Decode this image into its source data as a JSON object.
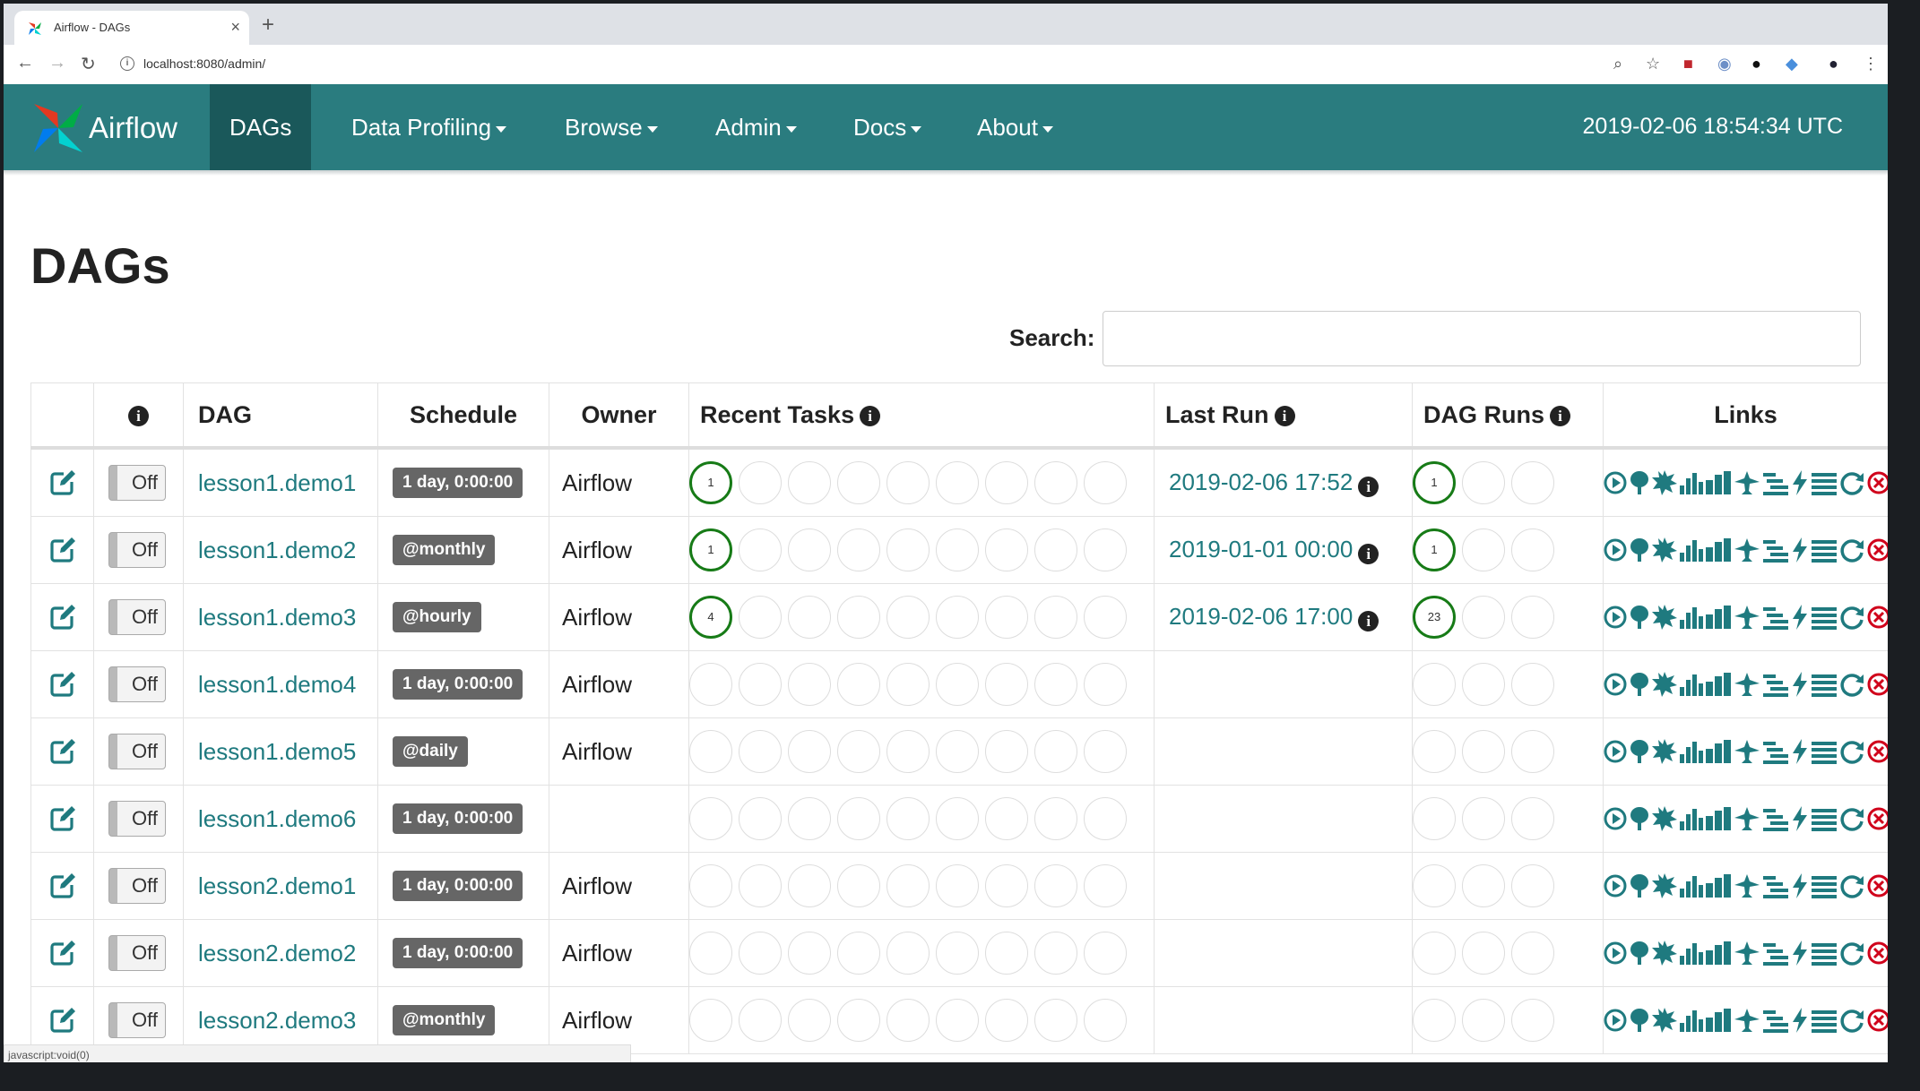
{
  "browser": {
    "tab_title": "Airflow - DAGs",
    "url": "localhost:8080/admin/"
  },
  "navbar": {
    "brand": "Airflow",
    "items": [
      {
        "label": "DAGs"
      },
      {
        "label": "Data Profiling"
      },
      {
        "label": "Browse"
      },
      {
        "label": "Admin"
      },
      {
        "label": "Docs"
      },
      {
        "label": "About"
      }
    ],
    "clock": "2019-02-06 18:54:34 UTC",
    "bg_color": "#2a7c7f",
    "active_color": "#1a585a"
  },
  "page": {
    "title": "DAGs",
    "search_label": "Search:",
    "search_value": ""
  },
  "table": {
    "headers": {
      "dag": "DAG",
      "schedule": "Schedule",
      "owner": "Owner",
      "recent_tasks": "Recent Tasks",
      "last_run": "Last Run",
      "dag_runs": "DAG Runs",
      "links": "Links"
    },
    "rows": [
      {
        "toggle": "Off",
        "dag": "lesson1.demo1",
        "schedule": "1 day, 0:00:00",
        "owner": "Airflow",
        "recent_task_count": "1",
        "last_run": "2019-02-06 17:52",
        "dag_run_count": "1"
      },
      {
        "toggle": "Off",
        "dag": "lesson1.demo2",
        "schedule": "@monthly",
        "owner": "Airflow",
        "recent_task_count": "1",
        "last_run": "2019-01-01 00:00",
        "dag_run_count": "1"
      },
      {
        "toggle": "Off",
        "dag": "lesson1.demo3",
        "schedule": "@hourly",
        "owner": "Airflow",
        "recent_task_count": "4",
        "last_run": "2019-02-06 17:00",
        "dag_run_count": "23"
      },
      {
        "toggle": "Off",
        "dag": "lesson1.demo4",
        "schedule": "1 day, 0:00:00",
        "owner": "Airflow",
        "recent_task_count": "",
        "last_run": "",
        "dag_run_count": ""
      },
      {
        "toggle": "Off",
        "dag": "lesson1.demo5",
        "schedule": "@daily",
        "owner": "Airflow",
        "recent_task_count": "",
        "last_run": "",
        "dag_run_count": ""
      },
      {
        "toggle": "Off",
        "dag": "lesson1.demo6",
        "schedule": "1 day, 0:00:00",
        "owner": "",
        "recent_task_count": "",
        "last_run": "",
        "dag_run_count": ""
      },
      {
        "toggle": "Off",
        "dag": "lesson2.demo1",
        "schedule": "1 day, 0:00:00",
        "owner": "Airflow",
        "recent_task_count": "",
        "last_run": "",
        "dag_run_count": ""
      },
      {
        "toggle": "Off",
        "dag": "lesson2.demo2",
        "schedule": "1 day, 0:00:00",
        "owner": "Airflow",
        "recent_task_count": "",
        "last_run": "",
        "dag_run_count": ""
      },
      {
        "toggle": "Off",
        "dag": "lesson2.demo3",
        "schedule": "@monthly",
        "owner": "Airflow",
        "recent_task_count": "",
        "last_run": "",
        "dag_run_count": ""
      }
    ],
    "link_icons": [
      "trigger-dag-icon",
      "tree-view-icon",
      "graph-view-icon",
      "task-duration-icon",
      "task-tries-icon",
      "landing-times-icon",
      "gantt-icon",
      "code-icon",
      "logs-icon",
      "refresh-icon",
      "delete-dag-icon"
    ],
    "link_color": "#1f7a7f",
    "success_color": "#177b17",
    "delete_color": "#d0021b"
  },
  "statusbar": {
    "text": "javascript:void(0)"
  }
}
